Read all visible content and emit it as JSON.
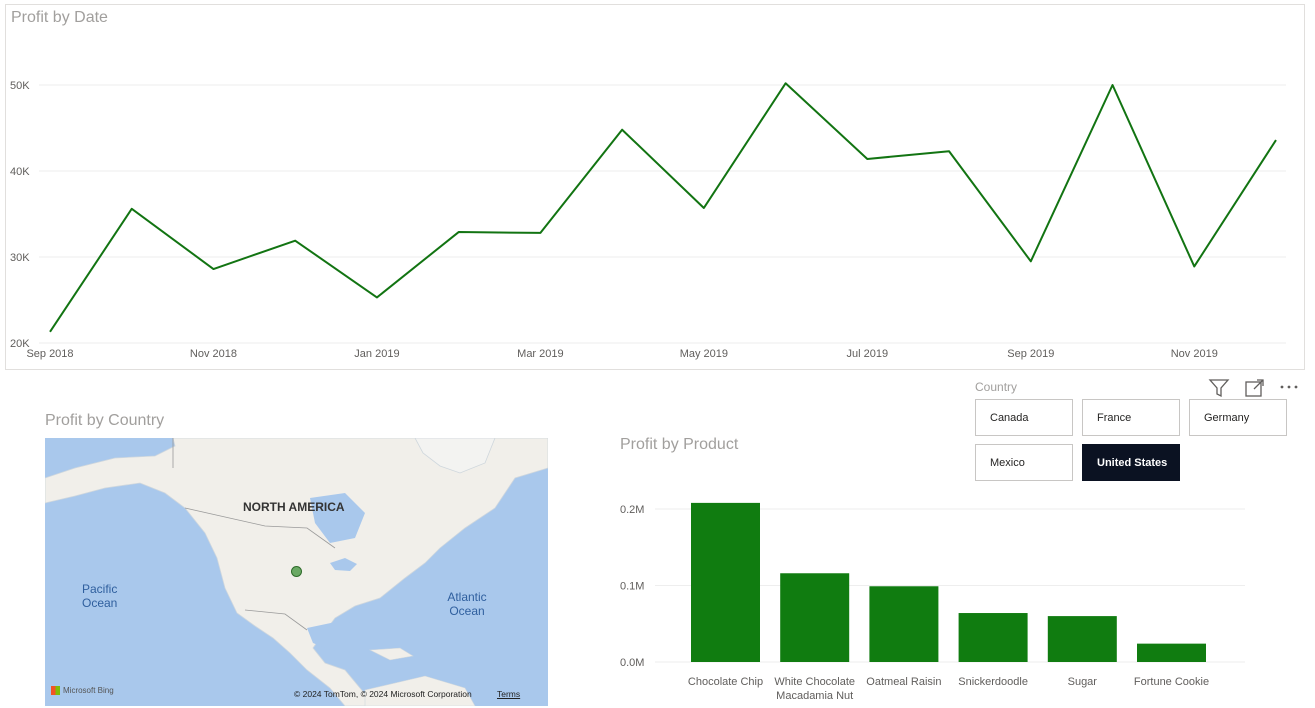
{
  "line_chart": {
    "title": "Profit by Date",
    "y_ticks": [
      "50K",
      "40K",
      "30K",
      "20K"
    ],
    "x_ticks": [
      "Sep 2018",
      "Nov 2018",
      "Jan 2019",
      "Mar 2019",
      "May 2019",
      "Jul 2019",
      "Sep 2019",
      "Nov 2019"
    ],
    "color": "#127412"
  },
  "slicer": {
    "header": "Country",
    "options": [
      "Canada",
      "France",
      "Germany",
      "Mexico",
      "United States"
    ],
    "selected": "United States"
  },
  "icons": [
    "filter-icon",
    "focus-mode-icon",
    "more-options-icon"
  ],
  "map": {
    "title": "Profit by Country",
    "continent_label": "NORTH AMERICA",
    "pacific_label_line1": "Pacific",
    "pacific_label_line2": "Ocean",
    "atlantic_label_line1": "Atlantic",
    "atlantic_label_line2": "Ocean",
    "bing_logo": "Microsoft Bing",
    "copyright": "© 2024 TomTom, © 2024 Microsoft Corporation",
    "terms": "Terms",
    "marker": {
      "country": "United States"
    },
    "water_color": "#a9c8ec",
    "land_color": "#f1efea"
  },
  "bar_chart": {
    "title": "Profit by Product",
    "y_ticks": [
      "0.2M",
      "0.1M",
      "0.0M"
    ],
    "color": "#107c10"
  },
  "chart_data": [
    {
      "type": "line",
      "title": "Profit by Date",
      "x": [
        "2018-09",
        "2018-10",
        "2018-11",
        "2018-12",
        "2019-01",
        "2019-02",
        "2019-03",
        "2019-04",
        "2019-05",
        "2019-06",
        "2019-07",
        "2019-08",
        "2019-09",
        "2019-10",
        "2019-11",
        "2019-12"
      ],
      "series": [
        {
          "values": [
            21300,
            35600,
            28600,
            31900,
            25300,
            32900,
            32800,
            44800,
            35700,
            50200,
            41400,
            42300,
            29500,
            50000,
            28900,
            43600
          ]
        }
      ],
      "ylim": [
        20000,
        50000
      ],
      "grid": true
    },
    {
      "type": "bar",
      "title": "Profit by Product",
      "categories": [
        "Chocolate Chip",
        "White Chocolate Macadamia Nut",
        "Oatmeal Raisin",
        "Snickerdoodle",
        "Sugar",
        "Fortune Cookie"
      ],
      "category_lines": [
        [
          "Chocolate Chip"
        ],
        [
          "White Chocolate",
          "Macadamia Nut"
        ],
        [
          "Oatmeal Raisin"
        ],
        [
          "Snickerdoodle"
        ],
        [
          "Sugar"
        ],
        [
          "Fortune Cookie"
        ]
      ],
      "values": [
        208000,
        116000,
        99000,
        64000,
        60000,
        24000
      ],
      "ylim": [
        0,
        200000
      ],
      "grid": true
    }
  ]
}
